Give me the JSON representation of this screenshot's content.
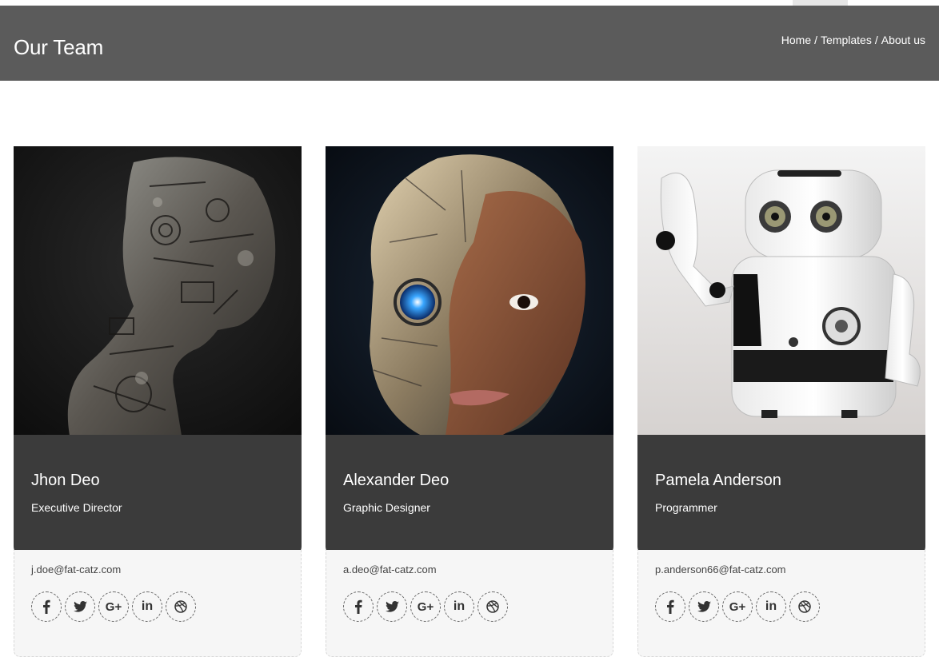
{
  "header": {
    "title": "Our Team",
    "breadcrumb": [
      "Home",
      "Templates",
      "About us"
    ],
    "background_color": "#5b5b5b"
  },
  "team": [
    {
      "name": "Jhon Deo",
      "role": "Executive Director",
      "email": "j.doe@fat-catz.com",
      "photo": "steampunk-robot-portrait"
    },
    {
      "name": "Alexander Deo",
      "role": "Graphic Designer",
      "email": "a.deo@fat-catz.com",
      "photo": "cyborg-woman-portrait"
    },
    {
      "name": "Pamela Anderson",
      "role": "Programmer",
      "email": "p.anderson66@fat-catz.com",
      "photo": "white-toy-robot-waving"
    }
  ],
  "social_icons": [
    "facebook-icon",
    "twitter-icon",
    "google-plus-icon",
    "linkedin-icon",
    "dribbble-icon"
  ],
  "colors": {
    "card_info_bg": "#3b3b3b",
    "card_footer_bg": "#f6f6f6"
  }
}
